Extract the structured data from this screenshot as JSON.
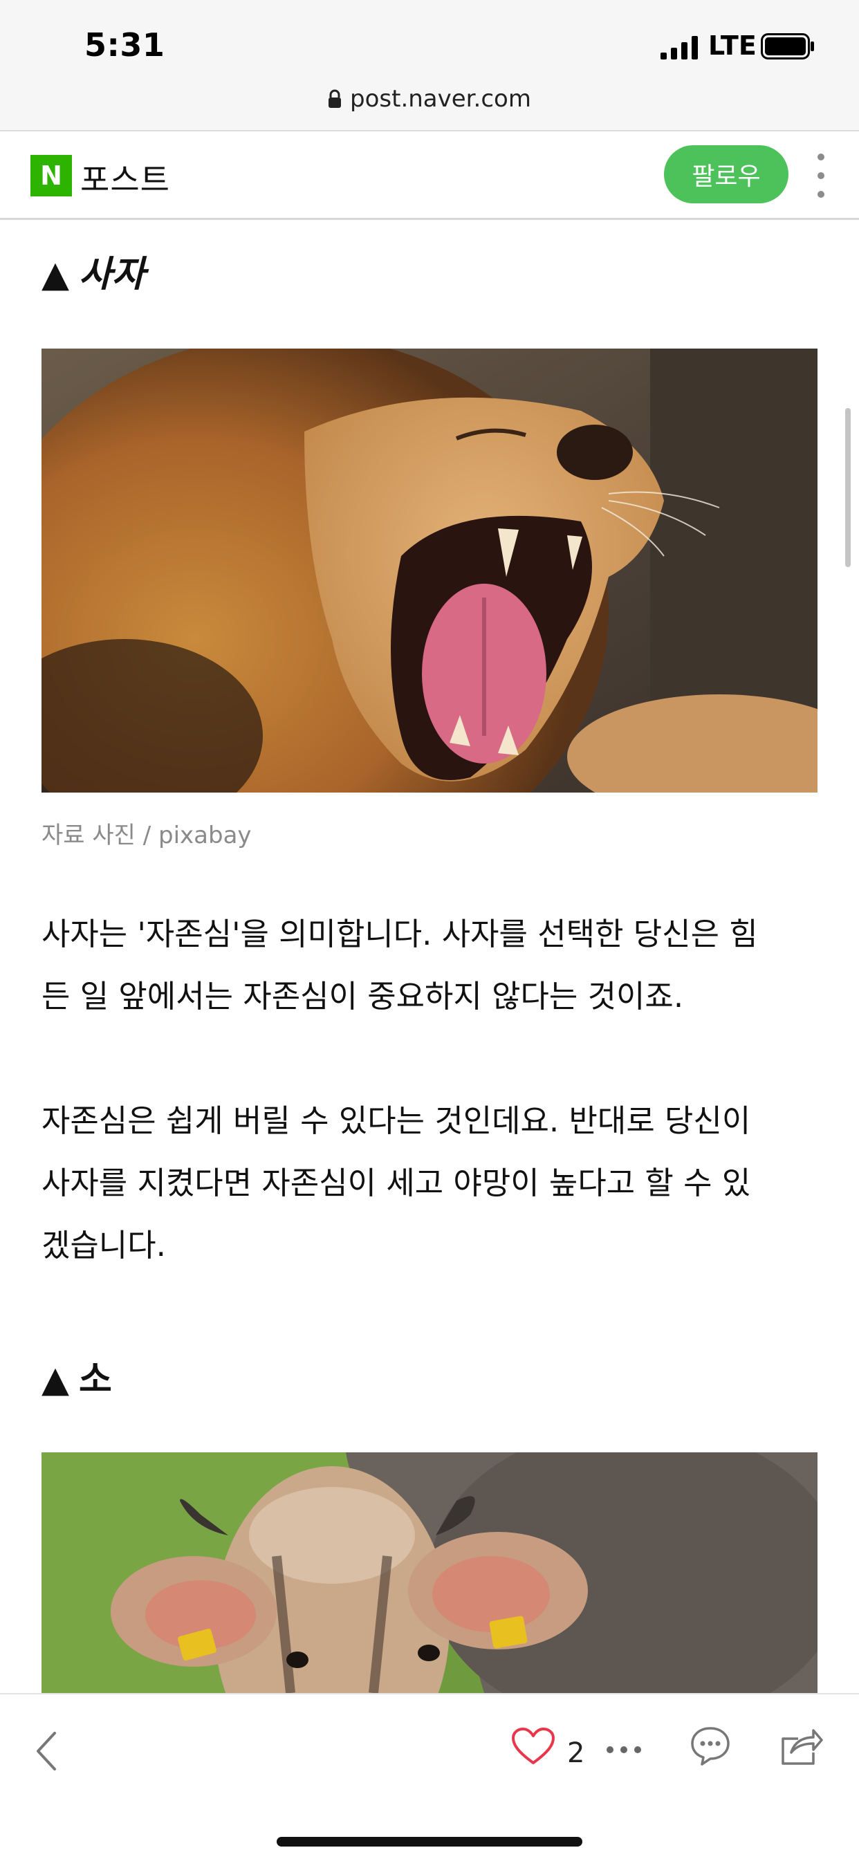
{
  "status_bar": {
    "time": "5:31",
    "network": "LTE"
  },
  "browser": {
    "url": "post.naver.com"
  },
  "header": {
    "logo_letter": "N",
    "brand": "포스트",
    "follow_label": "팔로우"
  },
  "article": {
    "section1_heading": "사자",
    "section1_caption": "자료 사진 / pixabay",
    "section1_para1_line1": "사자는 '자존심'을 의미합니다. 사자를 선택한 당신은 힘",
    "section1_para1_line2": "든 일 앞에서는 자존심이 중요하지 않다는 것이죠.",
    "section1_para2_line1": "자존심은 쉽게 버릴 수 있다는 것인데요. 반대로 당신이",
    "section1_para2_line2": "사자를 지켰다면 자존심이 세고 야망이 높다고 할 수 있",
    "section1_para2_line3": "겠습니다.",
    "section2_heading": "소",
    "heading_marker": "▲"
  },
  "toolbar": {
    "like_count": "2"
  },
  "colors": {
    "naver_green": "#2db400",
    "follow_green": "#4ec25a",
    "like_red": "#e8364a"
  },
  "icons": [
    "lock-icon",
    "kebab-menu-icon",
    "back-icon",
    "heart-icon",
    "more-icon",
    "comment-icon",
    "share-icon"
  ]
}
